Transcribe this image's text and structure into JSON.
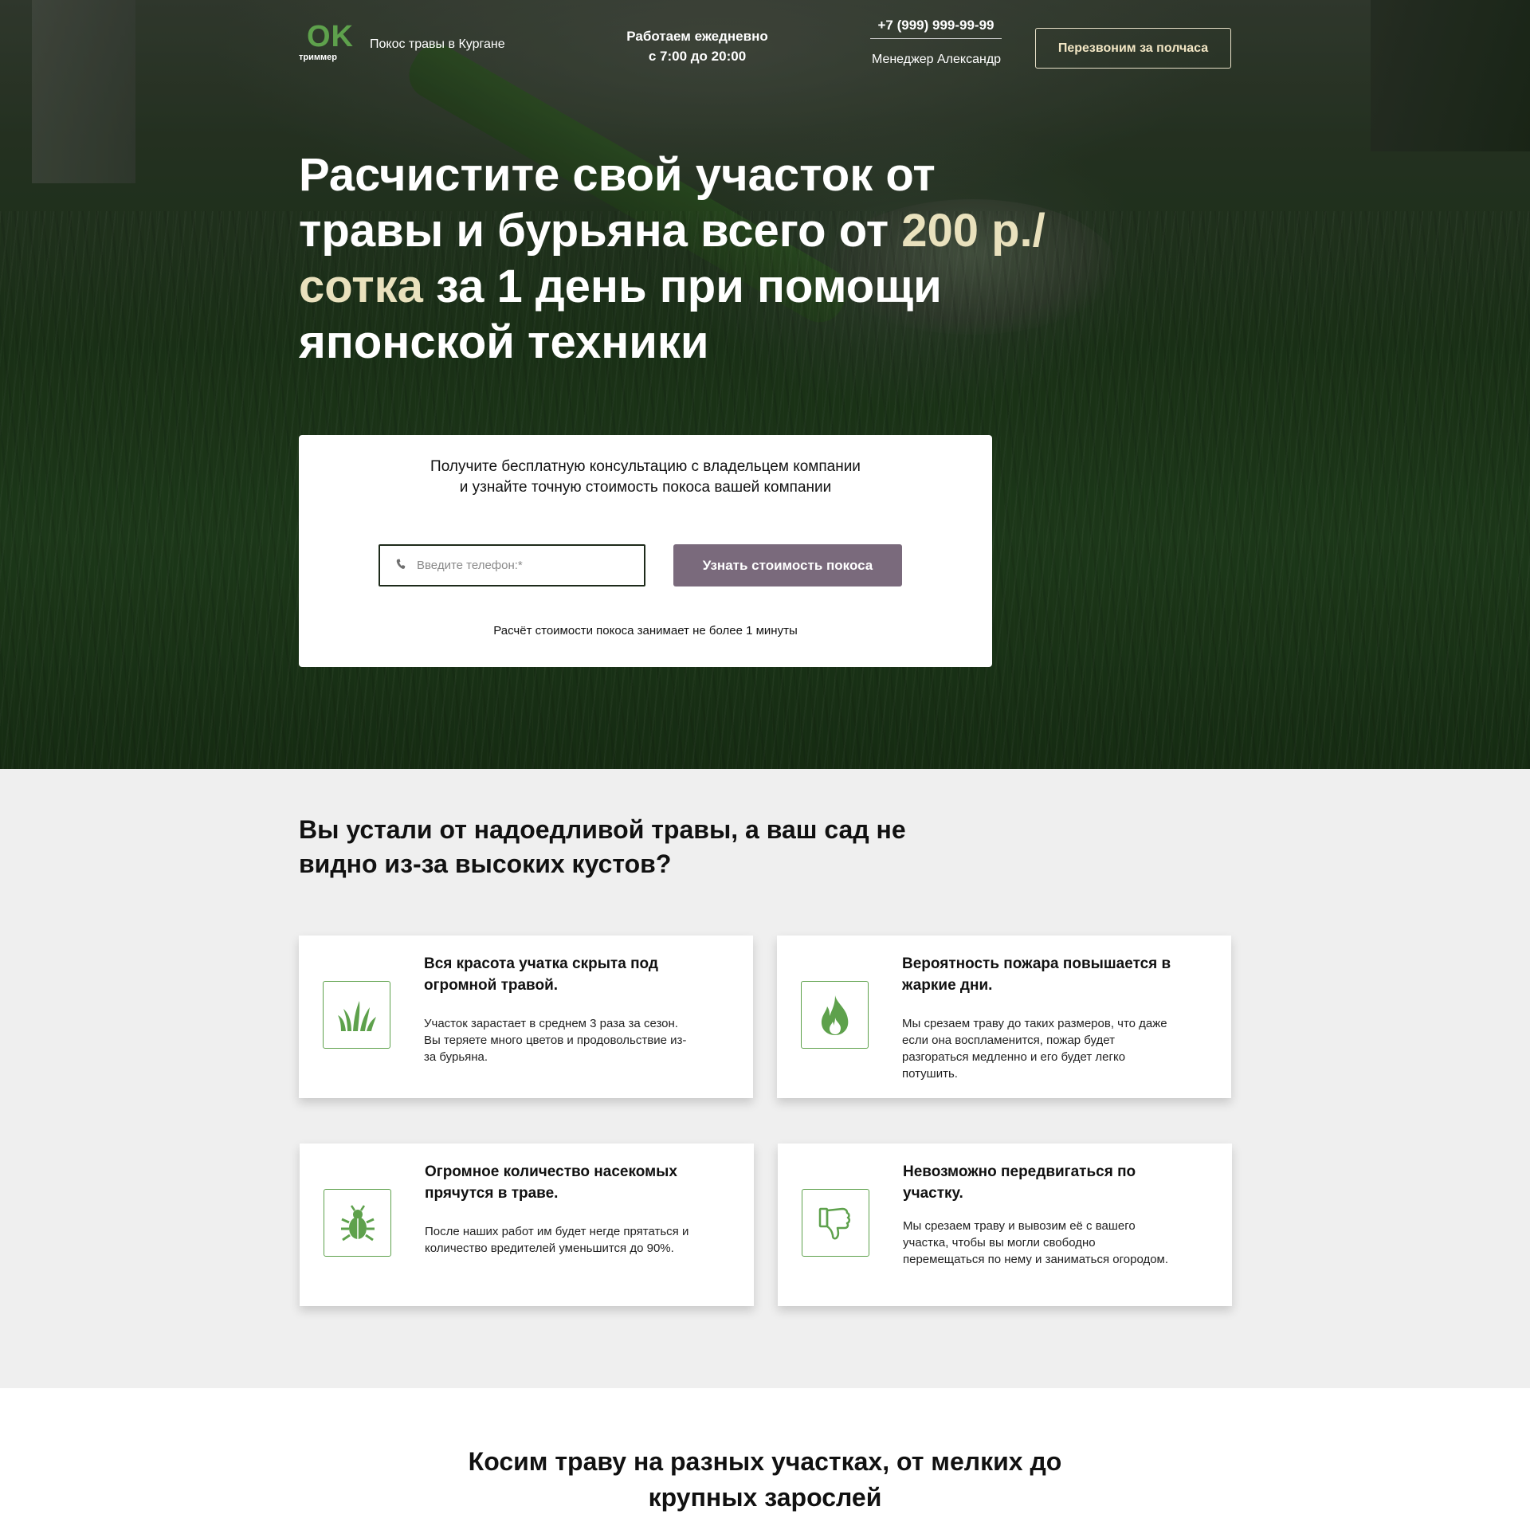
{
  "header": {
    "logo_main": "OK",
    "logo_sub": "триммер",
    "site_desc": "Покос травы в Кургане",
    "hours_line1": "Работаем ежедневно",
    "hours_line2": "с 7:00 до 20:00",
    "phone": "+7 (999) 999-99-99",
    "manager": "Менеджер Александр",
    "callback_label": "Перезвоним за полчаса"
  },
  "hero": {
    "title_part1": "Расчистите свой участок от травы и бурьяна всего от ",
    "title_accent": "200 р./сотка",
    "title_part2": " за 1 день при помощи японской техники"
  },
  "form": {
    "lead": "Получите бесплатную консультацию с владельцем компании и узнайте точную стоимость покоса вашей компании",
    "phone_placeholder": "Введите телефон:*",
    "phone_value": "",
    "submit_label": "Узнать стоимость покоса",
    "note": "Расчёт стоимости покоса занимает не более 1 минуты"
  },
  "problems": {
    "title": "Вы устали от надоедливой травы, а ваш сад не видно из-за высоких кустов?",
    "cards": [
      {
        "icon": "grass-icon",
        "title": "Вся красота учатка скрыта под огромной травой.",
        "text": "Участок зарастает в среднем 3 раза за сезон. Вы теряете много цветов и продовольствие из-за бурьяна."
      },
      {
        "icon": "fire-icon",
        "title": "Вероятность пожара повышается в жаркие дни.",
        "text": "Мы срезаем траву до таких размеров, что даже если она воспламенится, пожар будет разгораться медленно и его будет легко потушить."
      },
      {
        "icon": "bug-icon",
        "title": "Огромное количество насекомых прячутся в траве.",
        "text": "После наших работ им будет негде прятаться и количество вредителей уменьшится до 90%."
      },
      {
        "icon": "thumbs-down-icon",
        "title": "Невозможно передвигаться по участку.",
        "text": "Мы срезаем траву и вывозим её с вашего участка, чтобы вы могли свободно перемещаться по нему и заниматься огородом."
      }
    ]
  },
  "mowing": {
    "title": "Косим траву на разных участках, от мелких до крупных зарослей"
  },
  "colors": {
    "brand_green": "#5ea14c",
    "accent_cream": "#e9e1bd",
    "button_mauve": "#7a6a7c",
    "section_gray": "#efefef"
  }
}
